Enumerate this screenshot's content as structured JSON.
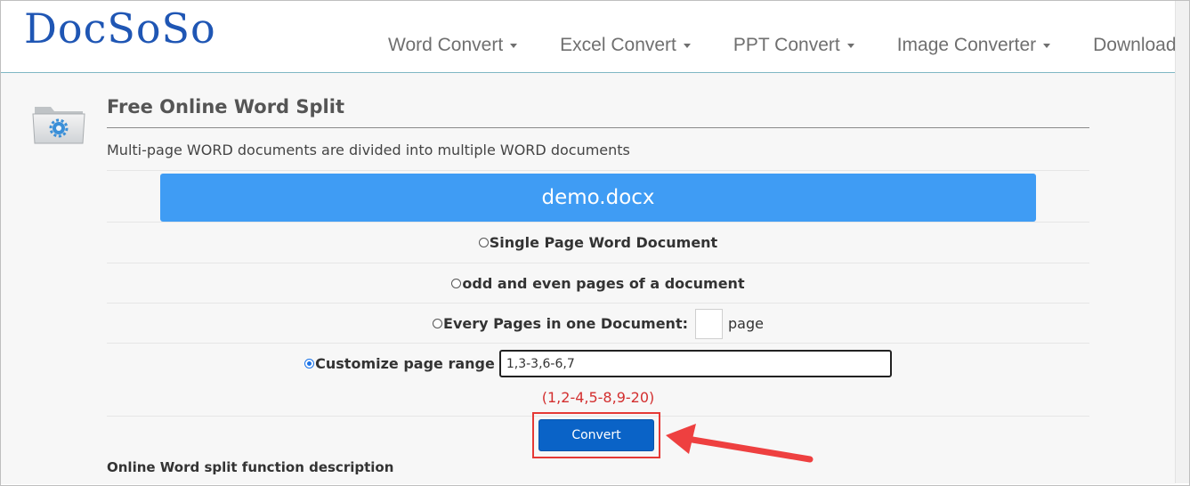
{
  "header": {
    "logo_text": "DocSoSo",
    "nav": [
      {
        "label": "Word Convert",
        "has_dropdown": true
      },
      {
        "label": "Excel Convert",
        "has_dropdown": true
      },
      {
        "label": "PPT Convert",
        "has_dropdown": true
      },
      {
        "label": "Image Converter",
        "has_dropdown": true
      },
      {
        "label": "Download",
        "has_dropdown": false
      }
    ]
  },
  "page": {
    "icon": "folder-gear-icon",
    "title": "Free Online Word Split",
    "description": "Multi-page WORD documents are divided into multiple WORD documents",
    "file_name": "demo.docx",
    "options": {
      "single_page": {
        "label": "Single Page Word Document",
        "checked": false
      },
      "odd_even": {
        "label": "odd and even pages of a document",
        "checked": false
      },
      "every_pages": {
        "label": "Every Pages in one Document:",
        "input_value": "",
        "unit": "page",
        "checked": false
      },
      "custom_range": {
        "label": "Customize page range",
        "input_value": "1,3-3,6-6,7",
        "checked": true
      }
    },
    "range_hint": "(1,2-4,5-8,9-20)",
    "convert_label": "Convert",
    "section_title": "Online Word split function description"
  },
  "colors": {
    "brand": "#1f56b4",
    "file_bar": "#3f9cf4",
    "button": "#0a63c7",
    "highlight": "#e53935",
    "hint": "#d32f2f"
  }
}
